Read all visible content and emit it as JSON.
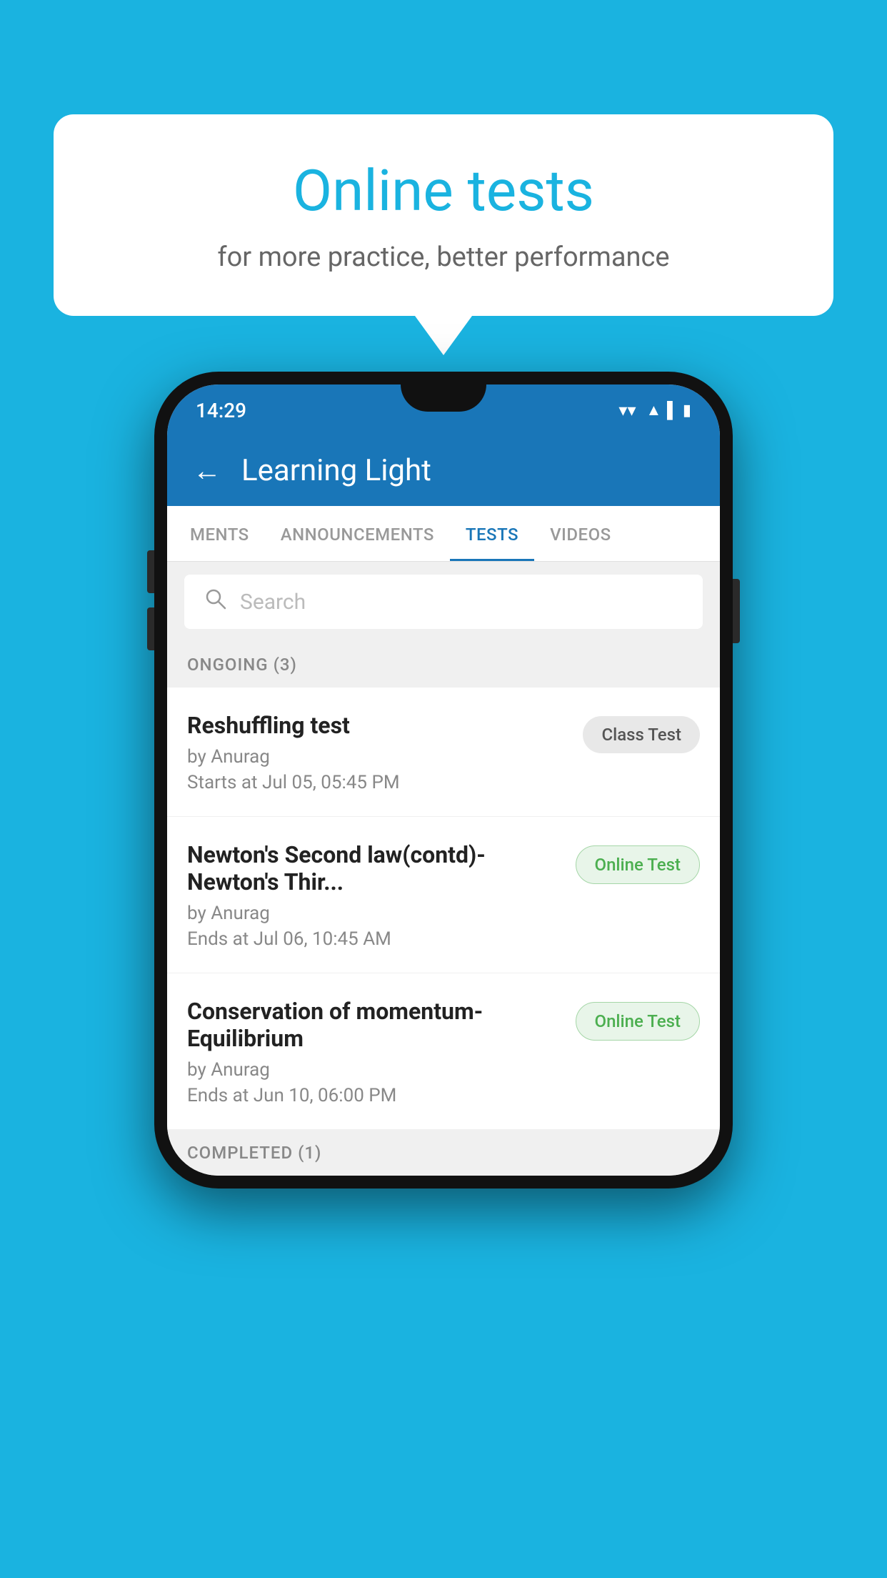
{
  "background": {
    "color": "#1ab3e0"
  },
  "speech_bubble": {
    "title": "Online tests",
    "subtitle": "for more practice, better performance"
  },
  "phone": {
    "status_bar": {
      "time": "14:29",
      "wifi": "▼",
      "signal": "▲",
      "battery": "▐"
    },
    "app_header": {
      "back_label": "←",
      "title": "Learning Light"
    },
    "tabs": [
      {
        "label": "MENTS",
        "active": false
      },
      {
        "label": "ANNOUNCEMENTS",
        "active": false
      },
      {
        "label": "TESTS",
        "active": true
      },
      {
        "label": "VIDEOS",
        "active": false
      }
    ],
    "search": {
      "placeholder": "Search"
    },
    "sections": [
      {
        "header": "ONGOING (3)",
        "tests": [
          {
            "name": "Reshuffling test",
            "author": "by Anurag",
            "time_label": "Starts at",
            "time": "Jul 05, 05:45 PM",
            "badge": "Class Test",
            "badge_type": "class"
          },
          {
            "name": "Newton's Second law(contd)-Newton's Thir...",
            "author": "by Anurag",
            "time_label": "Ends at",
            "time": "Jul 06, 10:45 AM",
            "badge": "Online Test",
            "badge_type": "online"
          },
          {
            "name": "Conservation of momentum-Equilibrium",
            "author": "by Anurag",
            "time_label": "Ends at",
            "time": "Jun 10, 06:00 PM",
            "badge": "Online Test",
            "badge_type": "online"
          }
        ]
      }
    ],
    "completed_header": "COMPLETED (1)"
  }
}
